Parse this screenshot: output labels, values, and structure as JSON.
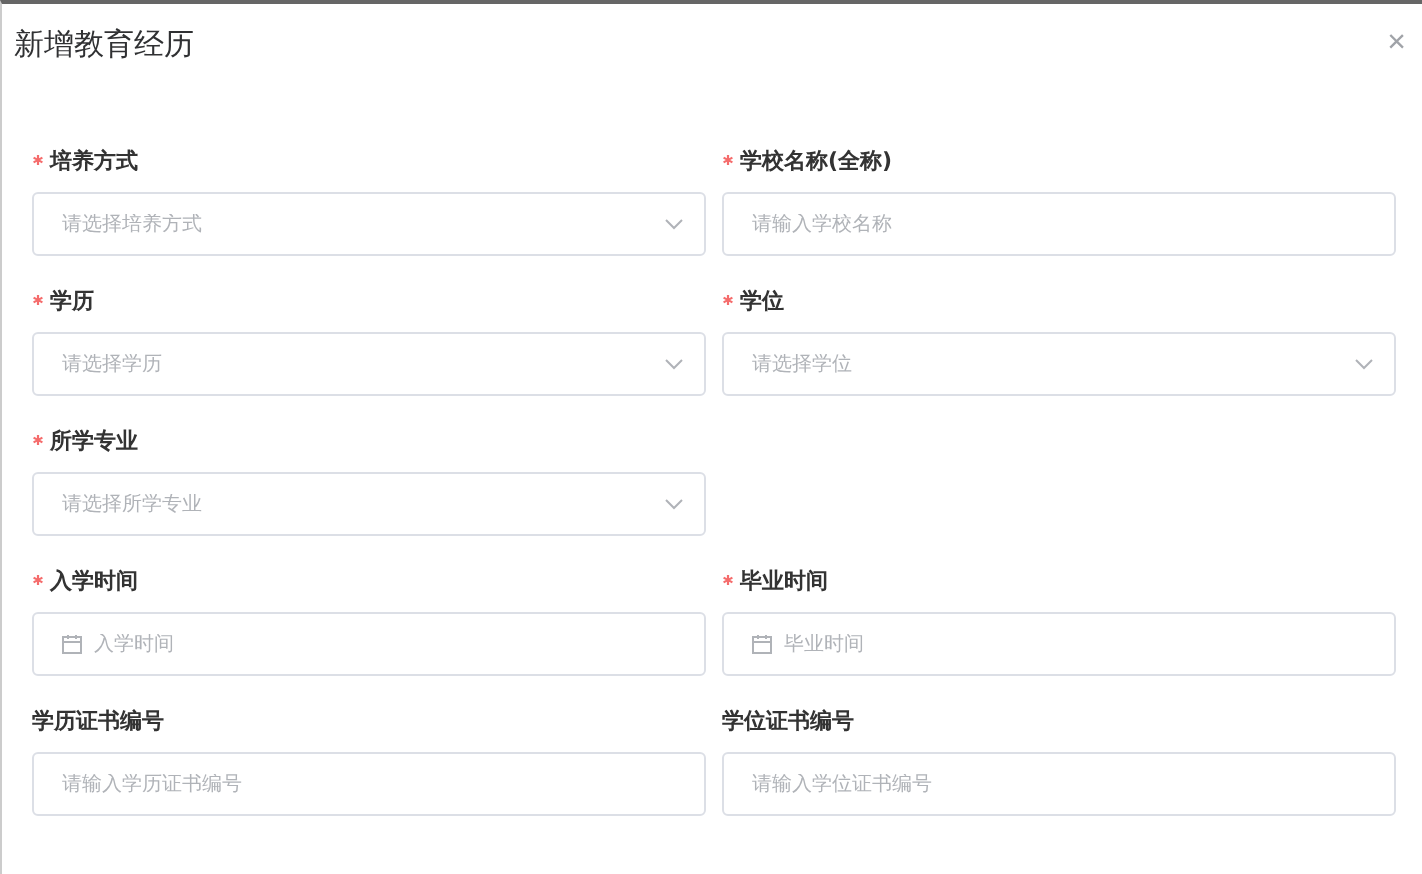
{
  "dialog": {
    "title": "新增教育经历",
    "close": "×"
  },
  "rows": [
    [
      {
        "label": "培养方式",
        "required": true,
        "kind": "select",
        "placeholder": "请选择培养方式"
      },
      {
        "label": "学校名称(全称)",
        "required": true,
        "kind": "input",
        "placeholder": "请输入学校名称"
      }
    ],
    [
      {
        "label": "学历",
        "required": true,
        "kind": "select",
        "placeholder": "请选择学历"
      },
      {
        "label": "学位",
        "required": true,
        "kind": "select",
        "placeholder": "请选择学位"
      }
    ],
    [
      {
        "label": "所学专业",
        "required": true,
        "kind": "select",
        "placeholder": "请选择所学专业"
      }
    ],
    [
      {
        "label": "入学时间",
        "required": true,
        "kind": "date",
        "placeholder": "入学时间"
      },
      {
        "label": "毕业时间",
        "required": true,
        "kind": "date",
        "placeholder": "毕业时间"
      }
    ],
    [
      {
        "label": "学历证书编号",
        "required": false,
        "kind": "input",
        "placeholder": "请输入学历证书编号"
      },
      {
        "label": "学位证书编号",
        "required": false,
        "kind": "input",
        "placeholder": "请输入学位证书编号"
      }
    ]
  ]
}
